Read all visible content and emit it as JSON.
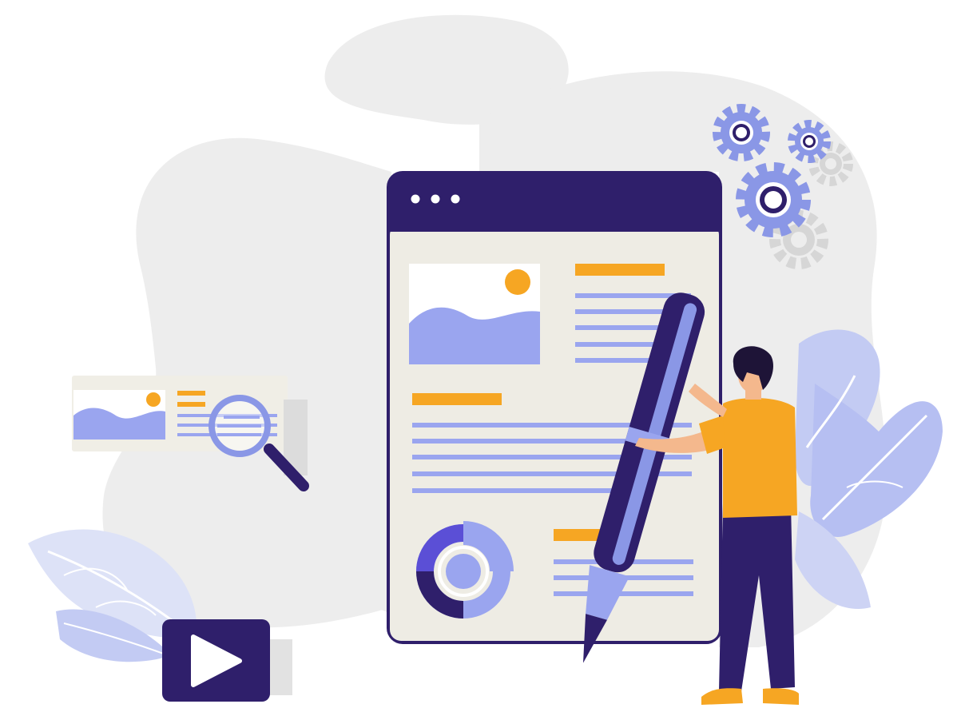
{
  "illustration": {
    "browser_window": {
      "dots": 3
    },
    "colors": {
      "background": "#ffffff",
      "blob": "#ededed",
      "window_frame": "#2f1f6b",
      "window_body": "#eeece4",
      "accent_orange": "#f6a623",
      "accent_periwinkle": "#9aa5ef",
      "leaf_light": "#c3cbf3",
      "gear_grey": "#d6d6d6",
      "skin": "#f4b88d",
      "hair": "#1e1437"
    },
    "icons": [
      "browser-window",
      "image-icon",
      "sun-icon",
      "donut-chart-icon",
      "magnifier-icon",
      "play-icon",
      "gear-icon",
      "pen-icon",
      "leaf-icon",
      "person-figure"
    ]
  }
}
